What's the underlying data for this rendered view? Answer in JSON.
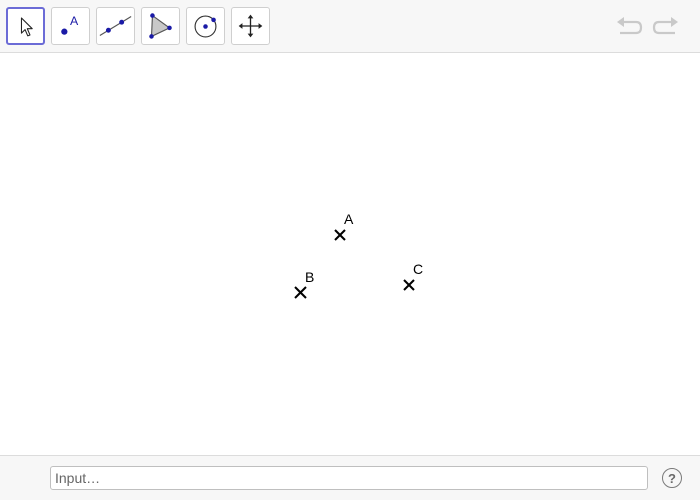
{
  "toolbar": {
    "tools": [
      {
        "icon": "move-arrow-icon",
        "active": true
      },
      {
        "icon": "point-icon",
        "label": "A"
      },
      {
        "icon": "line-icon"
      },
      {
        "icon": "polygon-icon"
      },
      {
        "icon": "circle-icon"
      },
      {
        "icon": "move-view-icon"
      }
    ],
    "undo_icon": "undo-icon",
    "redo_icon": "redo-icon"
  },
  "canvas": {
    "points": [
      {
        "name": "A"
      },
      {
        "name": "B"
      },
      {
        "name": "C"
      }
    ]
  },
  "input": {
    "placeholder": "Input…",
    "help_label": "?"
  },
  "colors": {
    "accent": "#6b6bd6",
    "point_tool_blue": "#1a1aa6",
    "toolbar_bg": "#f7f7f7"
  }
}
